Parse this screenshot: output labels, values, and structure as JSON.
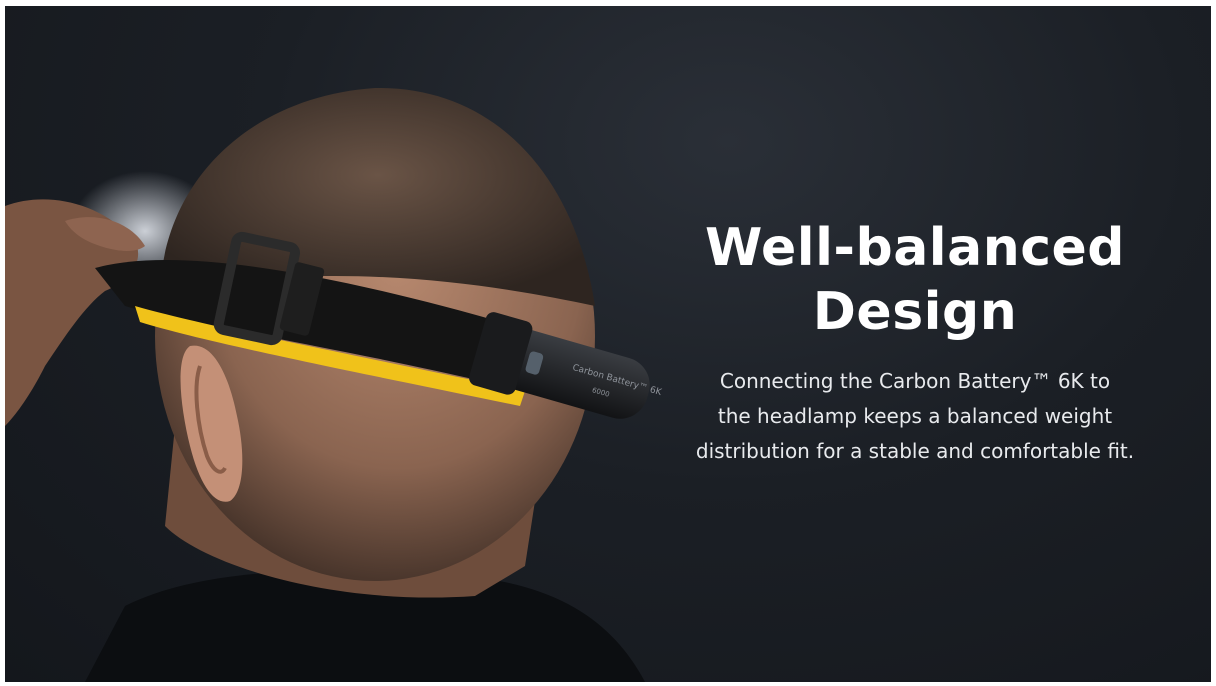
{
  "banner": {
    "headline": [
      "Well-balanced",
      "Design"
    ],
    "body_lines": [
      "Connecting the Carbon Battery™ 6K to",
      "the headlamp keeps a balanced weight",
      "distribution for a stable and comfortable fit."
    ],
    "battery_label_lines": [
      "Carbon Battery™ 6K",
      "6000"
    ]
  },
  "colors": {
    "background": "#1b1f25",
    "band": "#141414",
    "band_accent": "#f0c21a",
    "skin": "#b0826a",
    "hair": "#3a302a",
    "text": "#ffffff"
  }
}
